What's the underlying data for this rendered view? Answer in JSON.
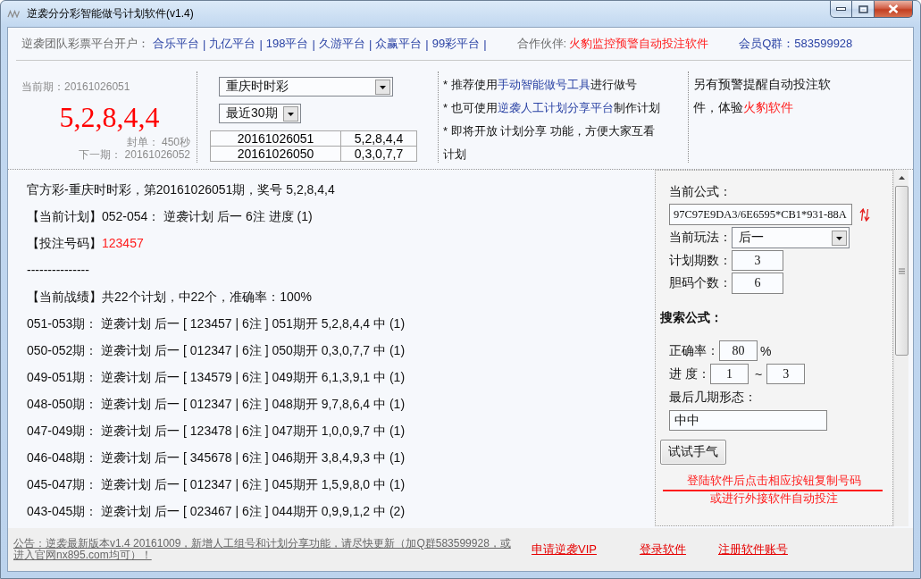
{
  "window": {
    "title": "逆袭分分彩智能做号计划软件(v1.4)"
  },
  "header": {
    "label": "逆袭团队彩票平台开户：",
    "platforms": [
      {
        "name": "合乐平台",
        "separator": "|"
      },
      {
        "name": "九亿平台",
        "separator": "|"
      },
      {
        "name": "198平台",
        "separator": "|"
      },
      {
        "name": "久游平台",
        "separator": "|"
      },
      {
        "name": "众赢平台",
        "separator": "|"
      },
      {
        "name": "99彩平台",
        "separator": "|"
      }
    ],
    "partner_label": "合作伙伴:",
    "partner": "火豹监控预警自动投注软件",
    "member_group": "会员Q群：583599928"
  },
  "draw": {
    "current_issue": "当前期：20161026051",
    "numbers": "5,2,8,4,4",
    "close_time": "封单： 450秒",
    "next_issue": "下一期： 20161026052"
  },
  "lottery_select": {
    "value": "重庆时时彩"
  },
  "range_select": {
    "value": "最近30期"
  },
  "history": {
    "rows": [
      {
        "issue": "20161026051",
        "numbers": "5,2,8,4,4"
      },
      {
        "issue": "20161026050",
        "numbers": "0,3,0,7,7"
      }
    ]
  },
  "tips": [
    {
      "parts": [
        {
          "text": "* 推荐使用",
          "kind": "plain"
        },
        {
          "text": "手动智能做号工具",
          "kind": "link"
        },
        {
          "text": "进行做号",
          "kind": "plain"
        }
      ]
    },
    {
      "parts": [
        {
          "text": "* 也可使用",
          "kind": "plain"
        },
        {
          "text": "逆袭人工计划分享平台",
          "kind": "link"
        },
        {
          "text": "制作计划",
          "kind": "plain"
        }
      ]
    },
    {
      "parts": [
        {
          "text": "* 即将开放 计划分享 功能，方便大家互看计划",
          "kind": "plain"
        }
      ]
    }
  ],
  "promo": {
    "parts": [
      {
        "text": "另有预警提醒自动投注软件，体验",
        "kind": "plain"
      },
      {
        "text": "火豹软件",
        "kind": "link"
      }
    ]
  },
  "result": {
    "lines": [
      {
        "parts": [
          {
            "text": "官方彩-重庆时时彩，第20161026051期，奖号 5,2,8,4,4",
            "kind": "plain"
          }
        ]
      },
      {
        "parts": [
          {
            "text": "【当前计划】052-054： 逆袭计划 后一 6注 进度 (1)",
            "kind": "plain"
          }
        ]
      },
      {
        "parts": [
          {
            "text": "【投注号码】",
            "kind": "plain"
          },
          {
            "text": "123457",
            "kind": "bet"
          }
        ]
      },
      {
        "parts": [
          {
            "text": "---------------",
            "kind": "plain"
          }
        ]
      },
      {
        "parts": [
          {
            "text": "【当前战绩】共22个计划，中22个，准确率：100%",
            "kind": "plain"
          }
        ]
      },
      {
        "parts": [
          {
            "text": "051-053期： 逆袭计划 后一 [ 123457 | 6注 ] 051期开 5,2,8,4,4 中 (1)",
            "kind": "plain"
          }
        ]
      },
      {
        "parts": [
          {
            "text": "050-052期： 逆袭计划 后一 [ 012347 | 6注 ] 050期开 0,3,0,7,7 中 (1)",
            "kind": "plain"
          }
        ]
      },
      {
        "parts": [
          {
            "text": "049-051期： 逆袭计划 后一 [ 134579 | 6注 ] 049期开 6,1,3,9,1 中 (1)",
            "kind": "plain"
          }
        ]
      },
      {
        "parts": [
          {
            "text": "048-050期： 逆袭计划 后一 [ 012347 | 6注 ] 048期开 9,7,8,6,4 中 (1)",
            "kind": "plain"
          }
        ]
      },
      {
        "parts": [
          {
            "text": "047-049期： 逆袭计划 后一 [ 123478 | 6注 ] 047期开 1,0,0,9,7 中 (1)",
            "kind": "plain"
          }
        ]
      },
      {
        "parts": [
          {
            "text": "046-048期： 逆袭计划 后一 [ 345678 | 6注 ] 046期开 3,8,4,9,3 中 (1)",
            "kind": "plain"
          }
        ]
      },
      {
        "parts": [
          {
            "text": "045-047期： 逆袭计划 后一 [ 012347 | 6注 ] 045期开 1,5,9,8,0 中 (1)",
            "kind": "plain"
          }
        ]
      },
      {
        "parts": [
          {
            "text": "043-045期： 逆袭计划 后一 [ 023467 | 6注 ] 044期开 0,9,9,1,2 中 (2)",
            "kind": "plain"
          }
        ]
      }
    ]
  },
  "panel": {
    "formula": {
      "label": "当前公式：",
      "value": "97C97E9DA3/6E6595*CB1*931-88A"
    },
    "play_mode": {
      "label": "当前玩法：",
      "value": "后一"
    },
    "plan_periods": {
      "label": "计划期数：",
      "value": "3"
    },
    "bet_count": {
      "label": "胆码个数：",
      "value": "6"
    },
    "search_title": "搜索公式：",
    "accuracy": {
      "label": "正确率：",
      "value": "80",
      "unit": "%"
    },
    "progress": {
      "label": "进 度：",
      "from": "1",
      "separator": "~",
      "to": "3"
    },
    "pattern": {
      "label": "最后几期形态：",
      "value": "中中"
    },
    "try_button": "试试手气",
    "hint": [
      "登陆软件后点击相应按钮复制号码",
      "或进行外接软件自动投注"
    ]
  },
  "footer": {
    "notice": "公告：逆袭最新版本v1.4 20161009，新增人工组号和计划分享功能，请尽快更新（加Q群583599928，或进入官网nx895.com均可）！",
    "links": [
      "申请逆袭VIP",
      "登录软件",
      "注册软件账号"
    ]
  }
}
